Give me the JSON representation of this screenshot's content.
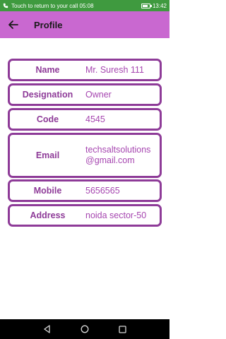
{
  "status_bar": {
    "left_text": "Touch to return to your call 05:08",
    "time": "13:42",
    "battery": "38"
  },
  "app_bar": {
    "title": "Profile",
    "back_icon": "arrow-left-icon"
  },
  "profile": [
    {
      "label": "Name",
      "value": "Mr. Suresh 111"
    },
    {
      "label": "Designation",
      "value": "Owner"
    },
    {
      "label": "Code",
      "value": "4545"
    },
    {
      "label": "Email",
      "value": "techsaltsolutions@gmail.com"
    },
    {
      "label": "Mobile",
      "value": "5656565"
    },
    {
      "label": "Address",
      "value": "noida sector-50"
    }
  ],
  "nav_bar": {
    "back": "triangle-back-icon",
    "home": "circle-home-icon",
    "recents": "square-recents-icon"
  },
  "colors": {
    "status_bar": "#3f9a3f",
    "app_bar": "#c968d0",
    "card_border": "#8e3b98",
    "value_text": "#a646b0"
  }
}
